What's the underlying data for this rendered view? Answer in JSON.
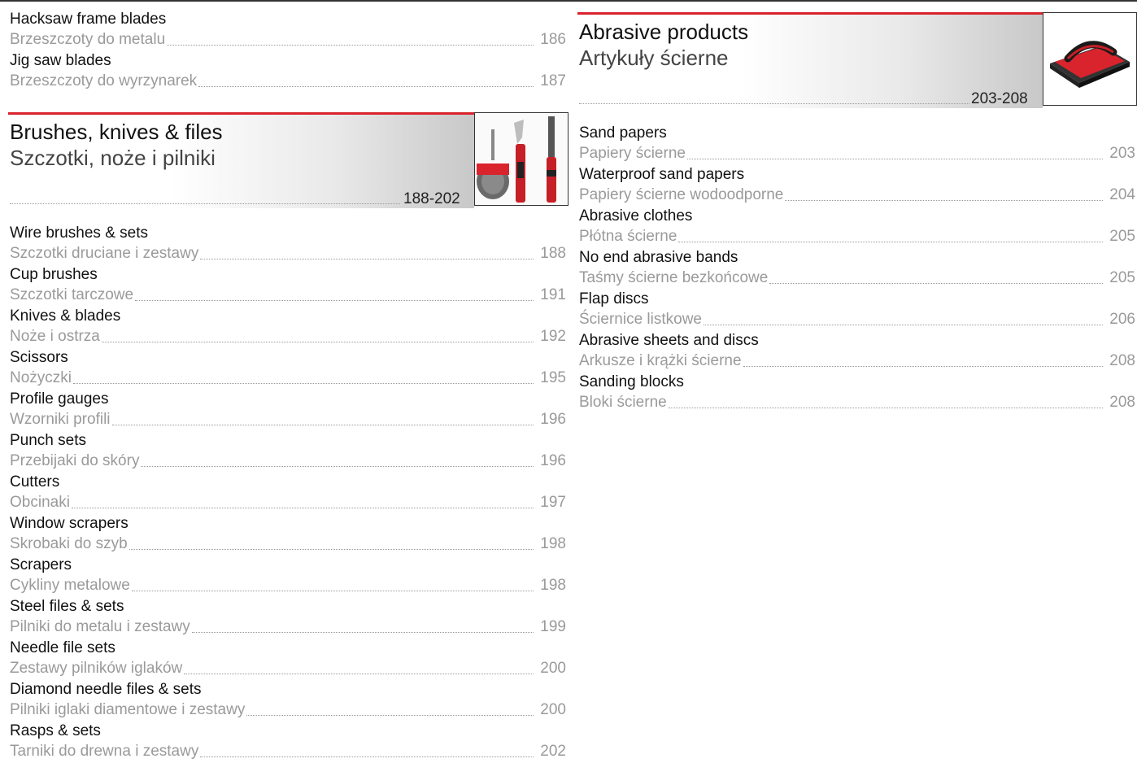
{
  "left_top_entries": [
    {
      "en": "Hacksaw frame blades",
      "pl": "Brzeszczoty do metalu",
      "page": "186"
    },
    {
      "en": "Jig saw blades",
      "pl": "Brzeszczoty do wyrzynarek",
      "page": "187"
    }
  ],
  "brushes_section": {
    "title": "Brushes, knives & files",
    "subtitle": "Szczotki, noże i pilniki",
    "range": "188-202",
    "entries": [
      {
        "en": "Wire brushes & sets",
        "pl": "Szczotki druciane i zestawy",
        "page": "188"
      },
      {
        "en": "Cup brushes",
        "pl": "Szczotki tarczowe",
        "page": "191"
      },
      {
        "en": "Knives & blades",
        "pl": "Noże i ostrza",
        "page": "192"
      },
      {
        "en": "Scissors",
        "pl": "Nożyczki",
        "page": "195"
      },
      {
        "en": "Profile gauges",
        "pl": "Wzorniki profili",
        "page": "196"
      },
      {
        "en": "Punch sets",
        "pl": "Przebijaki do skóry",
        "page": "196"
      },
      {
        "en": "Cutters",
        "pl": "Obcinaki",
        "page": "197"
      },
      {
        "en": "Window scrapers",
        "pl": "Skrobaki do szyb",
        "page": "198"
      },
      {
        "en": "Scrapers",
        "pl": "Cykliny metalowe",
        "page": "198"
      },
      {
        "en": "Steel files & sets",
        "pl": "Pilniki do metalu i zestawy",
        "page": "199"
      },
      {
        "en": "Needle file sets",
        "pl": "Zestawy pilników iglaków",
        "page": "200"
      },
      {
        "en": "Diamond needle files & sets",
        "pl": "Pilniki iglaki diamentowe i zestawy",
        "page": "200"
      },
      {
        "en": "Rasps & sets",
        "pl": "Tarniki do drewna i zestawy",
        "page": "202"
      }
    ]
  },
  "abrasive_section": {
    "title": "Abrasive products",
    "subtitle": "Artykuły ścierne",
    "range": "203-208",
    "entries": [
      {
        "en": "Sand papers",
        "pl": "Papiery ścierne",
        "page": "203"
      },
      {
        "en": "Waterproof sand papers",
        "pl": "Papiery ścierne wodoodporne",
        "page": "204"
      },
      {
        "en": "Abrasive clothes",
        "pl": "Płótna ścierne",
        "page": "205"
      },
      {
        "en": "No end abrasive bands",
        "pl": "Taśmy ścierne bezkońcowe",
        "page": "205"
      },
      {
        "en": "Flap discs",
        "pl": "Ściernice listkowe",
        "page": "206"
      },
      {
        "en": "Abrasive sheets and discs",
        "pl": "Arkusze i krążki ścierne",
        "page": "208"
      },
      {
        "en": "Sanding blocks",
        "pl": "Bloki ścierne",
        "page": "208"
      }
    ]
  },
  "colors": {
    "accent": "#d9232d",
    "secondary_text": "#9a9a9a"
  },
  "images": {
    "brushes_photo": "wire-brush-knife-file-photo",
    "abrasive_photo": "sanding-block-photo"
  }
}
